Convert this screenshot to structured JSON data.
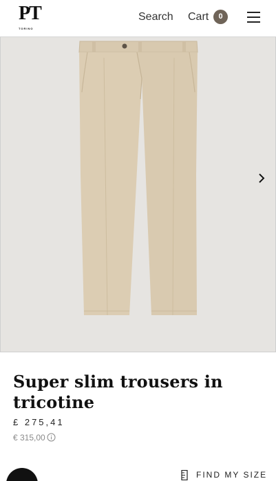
{
  "header": {
    "logo_text": "PT",
    "logo_sub": "TORINO",
    "search_label": "Search",
    "cart_label": "Cart",
    "cart_count": "0"
  },
  "gallery": {
    "image_desc": "beige-trousers-image",
    "next_icon": "chevron-right-icon"
  },
  "product": {
    "title": "Super slim trousers in tricotine",
    "price_gbp": "£ 275,41",
    "price_eur": "€ 315,00",
    "find_size_label": "FIND MY SIZE"
  },
  "colors": {
    "accent": "#6f6458",
    "gallery_bg": "#e6e4e1",
    "fabric": "#dccdb3"
  }
}
